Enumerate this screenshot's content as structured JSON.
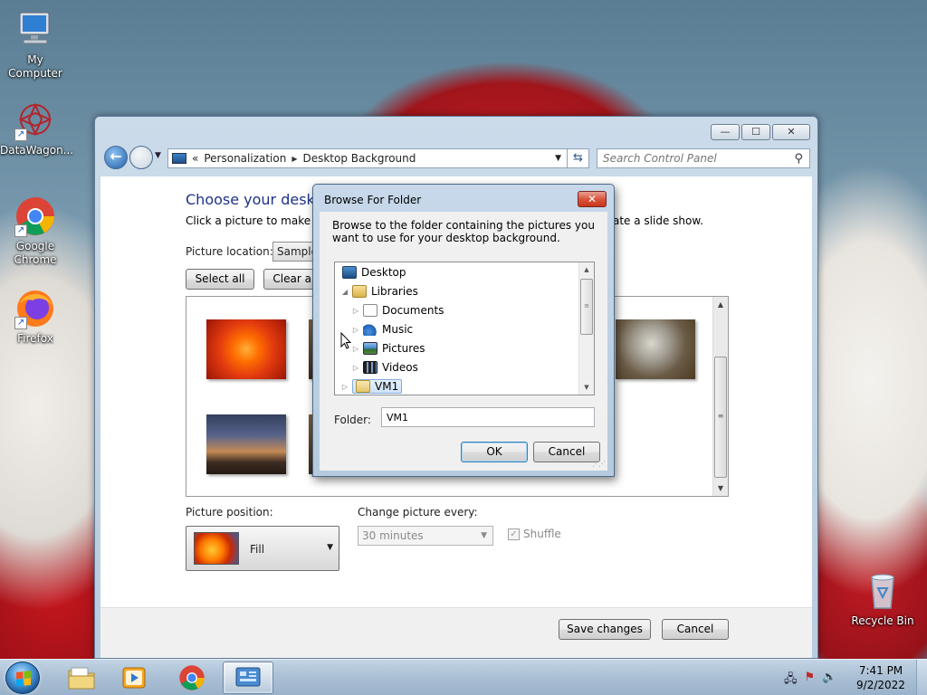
{
  "desktop": {
    "icons": [
      {
        "label": "My Computer"
      },
      {
        "label": "DataWagon..."
      },
      {
        "label": "Google Chrome"
      },
      {
        "label": "Firefox"
      },
      {
        "label": "Recycle Bin"
      }
    ]
  },
  "window": {
    "controls": {
      "minimize": "—",
      "maximize": "☐",
      "close": "✕"
    },
    "address": {
      "prefix": "«",
      "crumbs": [
        "Personalization",
        "Desktop Background"
      ]
    },
    "search": {
      "placeholder": "Search Control Panel"
    },
    "content": {
      "title": "Choose your desktop",
      "description": "Click a picture to make it y",
      "description_right": "ate a slide show.",
      "picture_location_label": "Picture location:",
      "picture_location_value": "Sample",
      "select_all": "Select all",
      "clear_all": "Clear all",
      "picture_position_label": "Picture position:",
      "picture_position_value": "Fill",
      "change_every_label": "Change picture every:",
      "change_every_value": "30 minutes",
      "shuffle_label": "Shuffle"
    },
    "footer": {
      "save": "Save changes",
      "cancel": "Cancel"
    }
  },
  "dialog": {
    "title": "Browse For Folder",
    "close": "✕",
    "description": "Browse to the folder containing the pictures you want to use for your desktop background.",
    "tree": [
      {
        "label": "Desktop",
        "icon": "desktop-icon"
      },
      {
        "label": "Libraries",
        "icon": "libraries-icon"
      },
      {
        "label": "Documents",
        "icon": "documents-icon"
      },
      {
        "label": "Music",
        "icon": "music-icon"
      },
      {
        "label": "Pictures",
        "icon": "pictures-icon"
      },
      {
        "label": "Videos",
        "icon": "videos-icon"
      },
      {
        "label": "VM1",
        "icon": "vm1-folder-icon",
        "selected": true
      }
    ],
    "folder_label": "Folder:",
    "folder_value": "VM1",
    "ok": "OK",
    "cancel": "Cancel"
  },
  "taskbar": {
    "clock_time": "7:41 PM",
    "clock_date": "9/2/2022"
  }
}
